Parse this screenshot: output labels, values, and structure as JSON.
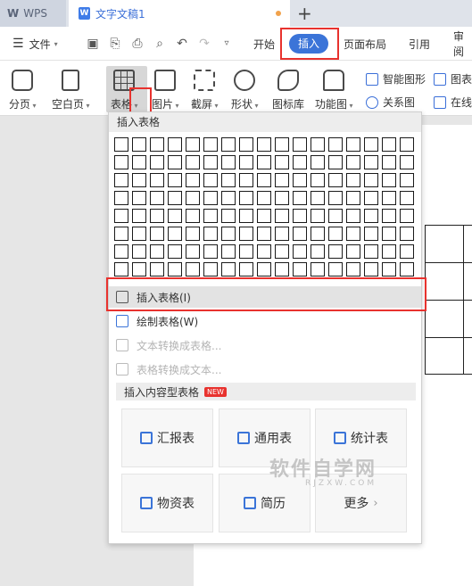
{
  "tabs": {
    "app": "WPS",
    "document": "文字文稿1",
    "add": "+"
  },
  "menubar": {
    "file": "文件",
    "items": [
      "开始",
      "插入",
      "页面布局",
      "引用",
      "审阅"
    ],
    "active": "插入"
  },
  "ribbon": {
    "buttons": [
      "分页",
      "空白页",
      "表格",
      "图片",
      "截屏",
      "形状",
      "图标库",
      "功能图"
    ],
    "small": [
      "智能图形",
      "图表",
      "关系图",
      "在线"
    ]
  },
  "dropdown": {
    "header": "插入表格",
    "grid": {
      "rows": 8,
      "cols": 17
    },
    "items": [
      {
        "label": "插入表格(I)",
        "state": "highlighted"
      },
      {
        "label": "绘制表格(W)",
        "state": "normal"
      },
      {
        "label": "文本转换成表格...",
        "state": "disabled"
      },
      {
        "label": "表格转换成文本...",
        "state": "disabled"
      }
    ],
    "content_header": "插入内容型表格",
    "new_badge": "NEW",
    "templates": [
      "汇报表",
      "通用表",
      "统计表",
      "物资表",
      "简历",
      "更多"
    ]
  },
  "watermark": {
    "main": "软件自学网",
    "sub": "RJZXW.COM"
  },
  "colors": {
    "accent": "#3b74d8",
    "highlight_box": "#e8322e",
    "modified_dot": "#f1a24b"
  }
}
